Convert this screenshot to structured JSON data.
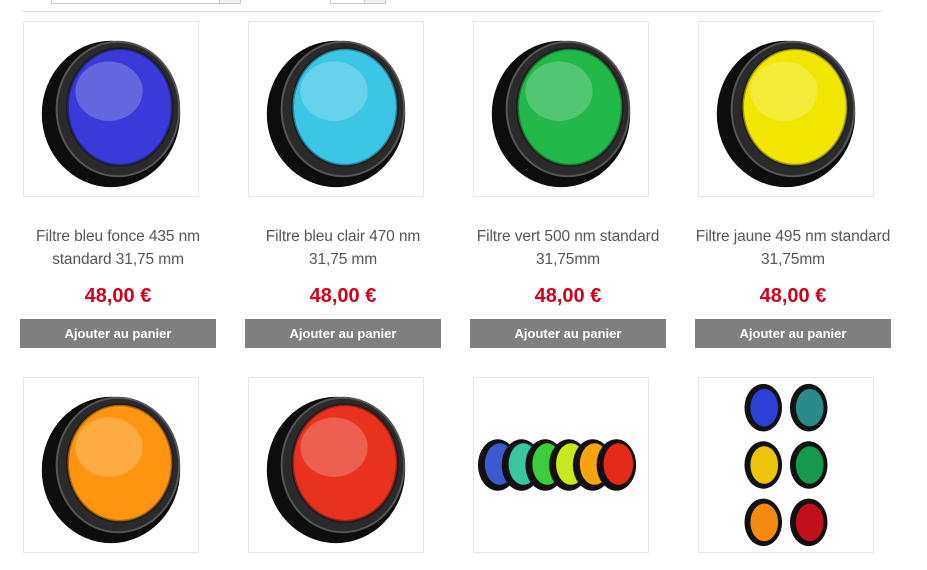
{
  "products": [
    {
      "title": "Filtre bleu fonce 435 nm standard 31,75 mm",
      "price": "48,00 €",
      "button": "Ajouter au panier",
      "color": "#3b3ad8",
      "image": "filter-blue-dark"
    },
    {
      "title": "Filtre bleu clair 470 nm 31,75 mm",
      "price": "48,00 €",
      "button": "Ajouter au panier",
      "color": "#3cc6e6",
      "image": "filter-blue-light"
    },
    {
      "title": "Filtre vert 500 nm standard 31,75mm",
      "price": "48,00 €",
      "button": "Ajouter au panier",
      "color": "#22b84a",
      "image": "filter-green"
    },
    {
      "title": "Filtre jaune 495 nm standard 31,75mm",
      "price": "48,00 €",
      "button": "Ajouter au panier",
      "color": "#f2e600",
      "image": "filter-yellow"
    },
    {
      "color": "#ff9410",
      "image": "filter-orange"
    },
    {
      "color": "#e8321e",
      "image": "filter-red"
    },
    {
      "image": "filter-set-row"
    },
    {
      "image": "filter-set-grid"
    }
  ],
  "filter_set_row_colors": [
    "#3a5ad0",
    "#38c6a0",
    "#3ccc3c",
    "#c8e81c",
    "#f7a410",
    "#e62a1a"
  ],
  "filter_set_grid_colors": [
    "#2c3fd6",
    "#2b8a8a",
    "#f0c40a",
    "#149a4a",
    "#f58a10",
    "#c0101c"
  ]
}
